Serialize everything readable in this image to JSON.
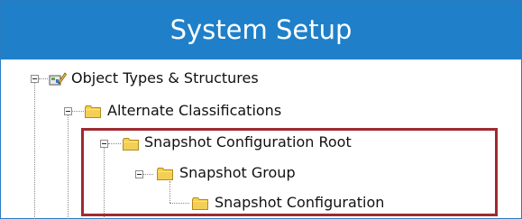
{
  "window": {
    "title": "System Setup"
  },
  "tree": {
    "items": [
      {
        "label": "Object Types & Structures",
        "icon": "object-types-icon",
        "expanded": true,
        "level": 0
      },
      {
        "label": "Alternate Classifications",
        "icon": "folder-icon",
        "expanded": true,
        "level": 1
      },
      {
        "label": "Snapshot Configuration Root",
        "icon": "folder-icon",
        "expanded": true,
        "level": 2
      },
      {
        "label": "Snapshot Group",
        "icon": "folder-icon",
        "expanded": true,
        "level": 3
      },
      {
        "label": "Snapshot Configuration",
        "icon": "folder-icon",
        "expanded": false,
        "level": 4
      }
    ]
  },
  "highlight": {
    "color": "#9f2a2f"
  },
  "colors": {
    "title_bar": "#1f80c9",
    "folder_fill": "#f4cf55",
    "folder_outline": "#b58b18"
  }
}
